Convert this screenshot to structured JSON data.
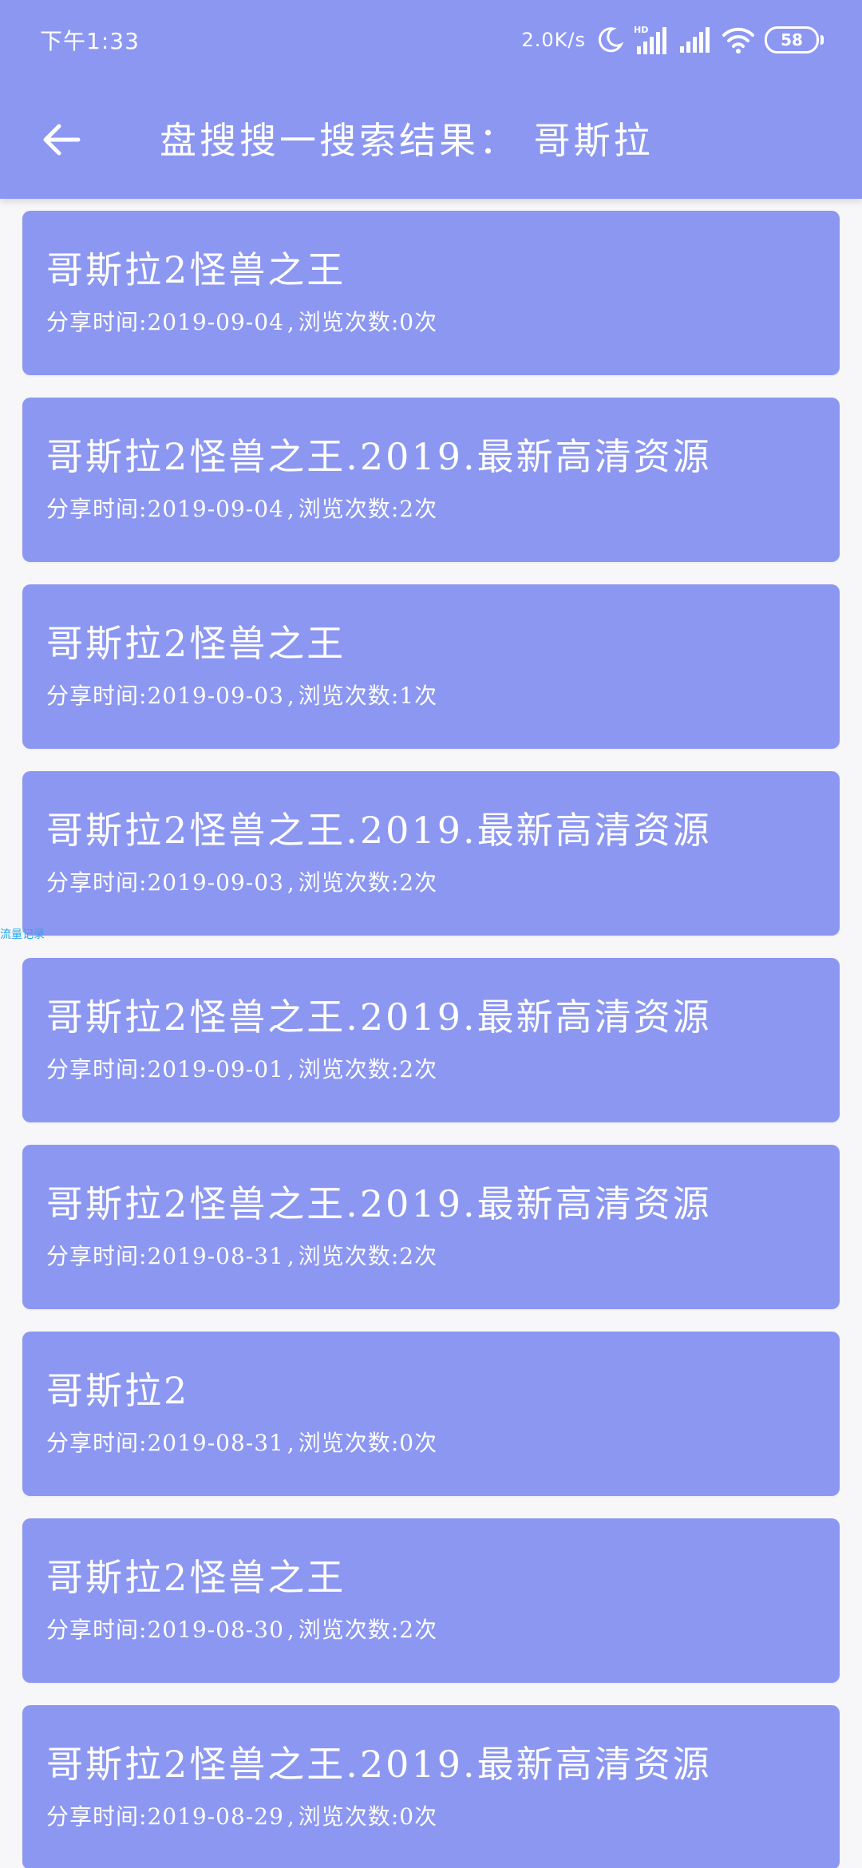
{
  "status_bar": {
    "time": "下午1:33",
    "network_speed": "2.0K/s",
    "hd_label": "HD",
    "battery": "58",
    "icons": [
      "moon-icon",
      "signal-hd-icon",
      "signal-icon",
      "wifi-icon",
      "battery-icon"
    ]
  },
  "toolbar": {
    "back_icon": "arrow-left-icon",
    "title": "盘搜搜一搜索结果：  哥斯拉"
  },
  "colors": {
    "primary": "#8c97f2",
    "background": "#f7f7f9",
    "text": "#ffffff",
    "overlay_text": "#29a8e8"
  },
  "overlay_label": "流量记录",
  "results": [
    {
      "title": "哥斯拉2怪兽之王",
      "share_label": "分享时间",
      "date": "2019-09-04",
      "views_label": "浏览次数",
      "views": "0",
      "unit": "次"
    },
    {
      "title": "哥斯拉2怪兽之王.2019.最新高清资源",
      "share_label": "分享时间",
      "date": "2019-09-04",
      "views_label": "浏览次数",
      "views": "2",
      "unit": "次"
    },
    {
      "title": "哥斯拉2怪兽之王",
      "share_label": "分享时间",
      "date": "2019-09-03",
      "views_label": "浏览次数",
      "views": "1",
      "unit": "次"
    },
    {
      "title": "哥斯拉2怪兽之王.2019.最新高清资源",
      "share_label": "分享时间",
      "date": "2019-09-03",
      "views_label": "浏览次数",
      "views": "2",
      "unit": "次"
    },
    {
      "title": "哥斯拉2怪兽之王.2019.最新高清资源",
      "share_label": "分享时间",
      "date": "2019-09-01",
      "views_label": "浏览次数",
      "views": "2",
      "unit": "次"
    },
    {
      "title": "哥斯拉2怪兽之王.2019.最新高清资源",
      "share_label": "分享时间",
      "date": "2019-08-31",
      "views_label": "浏览次数",
      "views": "2",
      "unit": "次"
    },
    {
      "title": "哥斯拉2",
      "share_label": "分享时间",
      "date": "2019-08-31",
      "views_label": "浏览次数",
      "views": "0",
      "unit": "次"
    },
    {
      "title": "哥斯拉2怪兽之王",
      "share_label": "分享时间",
      "date": "2019-08-30",
      "views_label": "浏览次数",
      "views": "2",
      "unit": "次"
    },
    {
      "title": "哥斯拉2怪兽之王.2019.最新高清资源",
      "share_label": "分享时间",
      "date": "2019-08-29",
      "views_label": "浏览次数",
      "views": "0",
      "unit": "次"
    }
  ]
}
